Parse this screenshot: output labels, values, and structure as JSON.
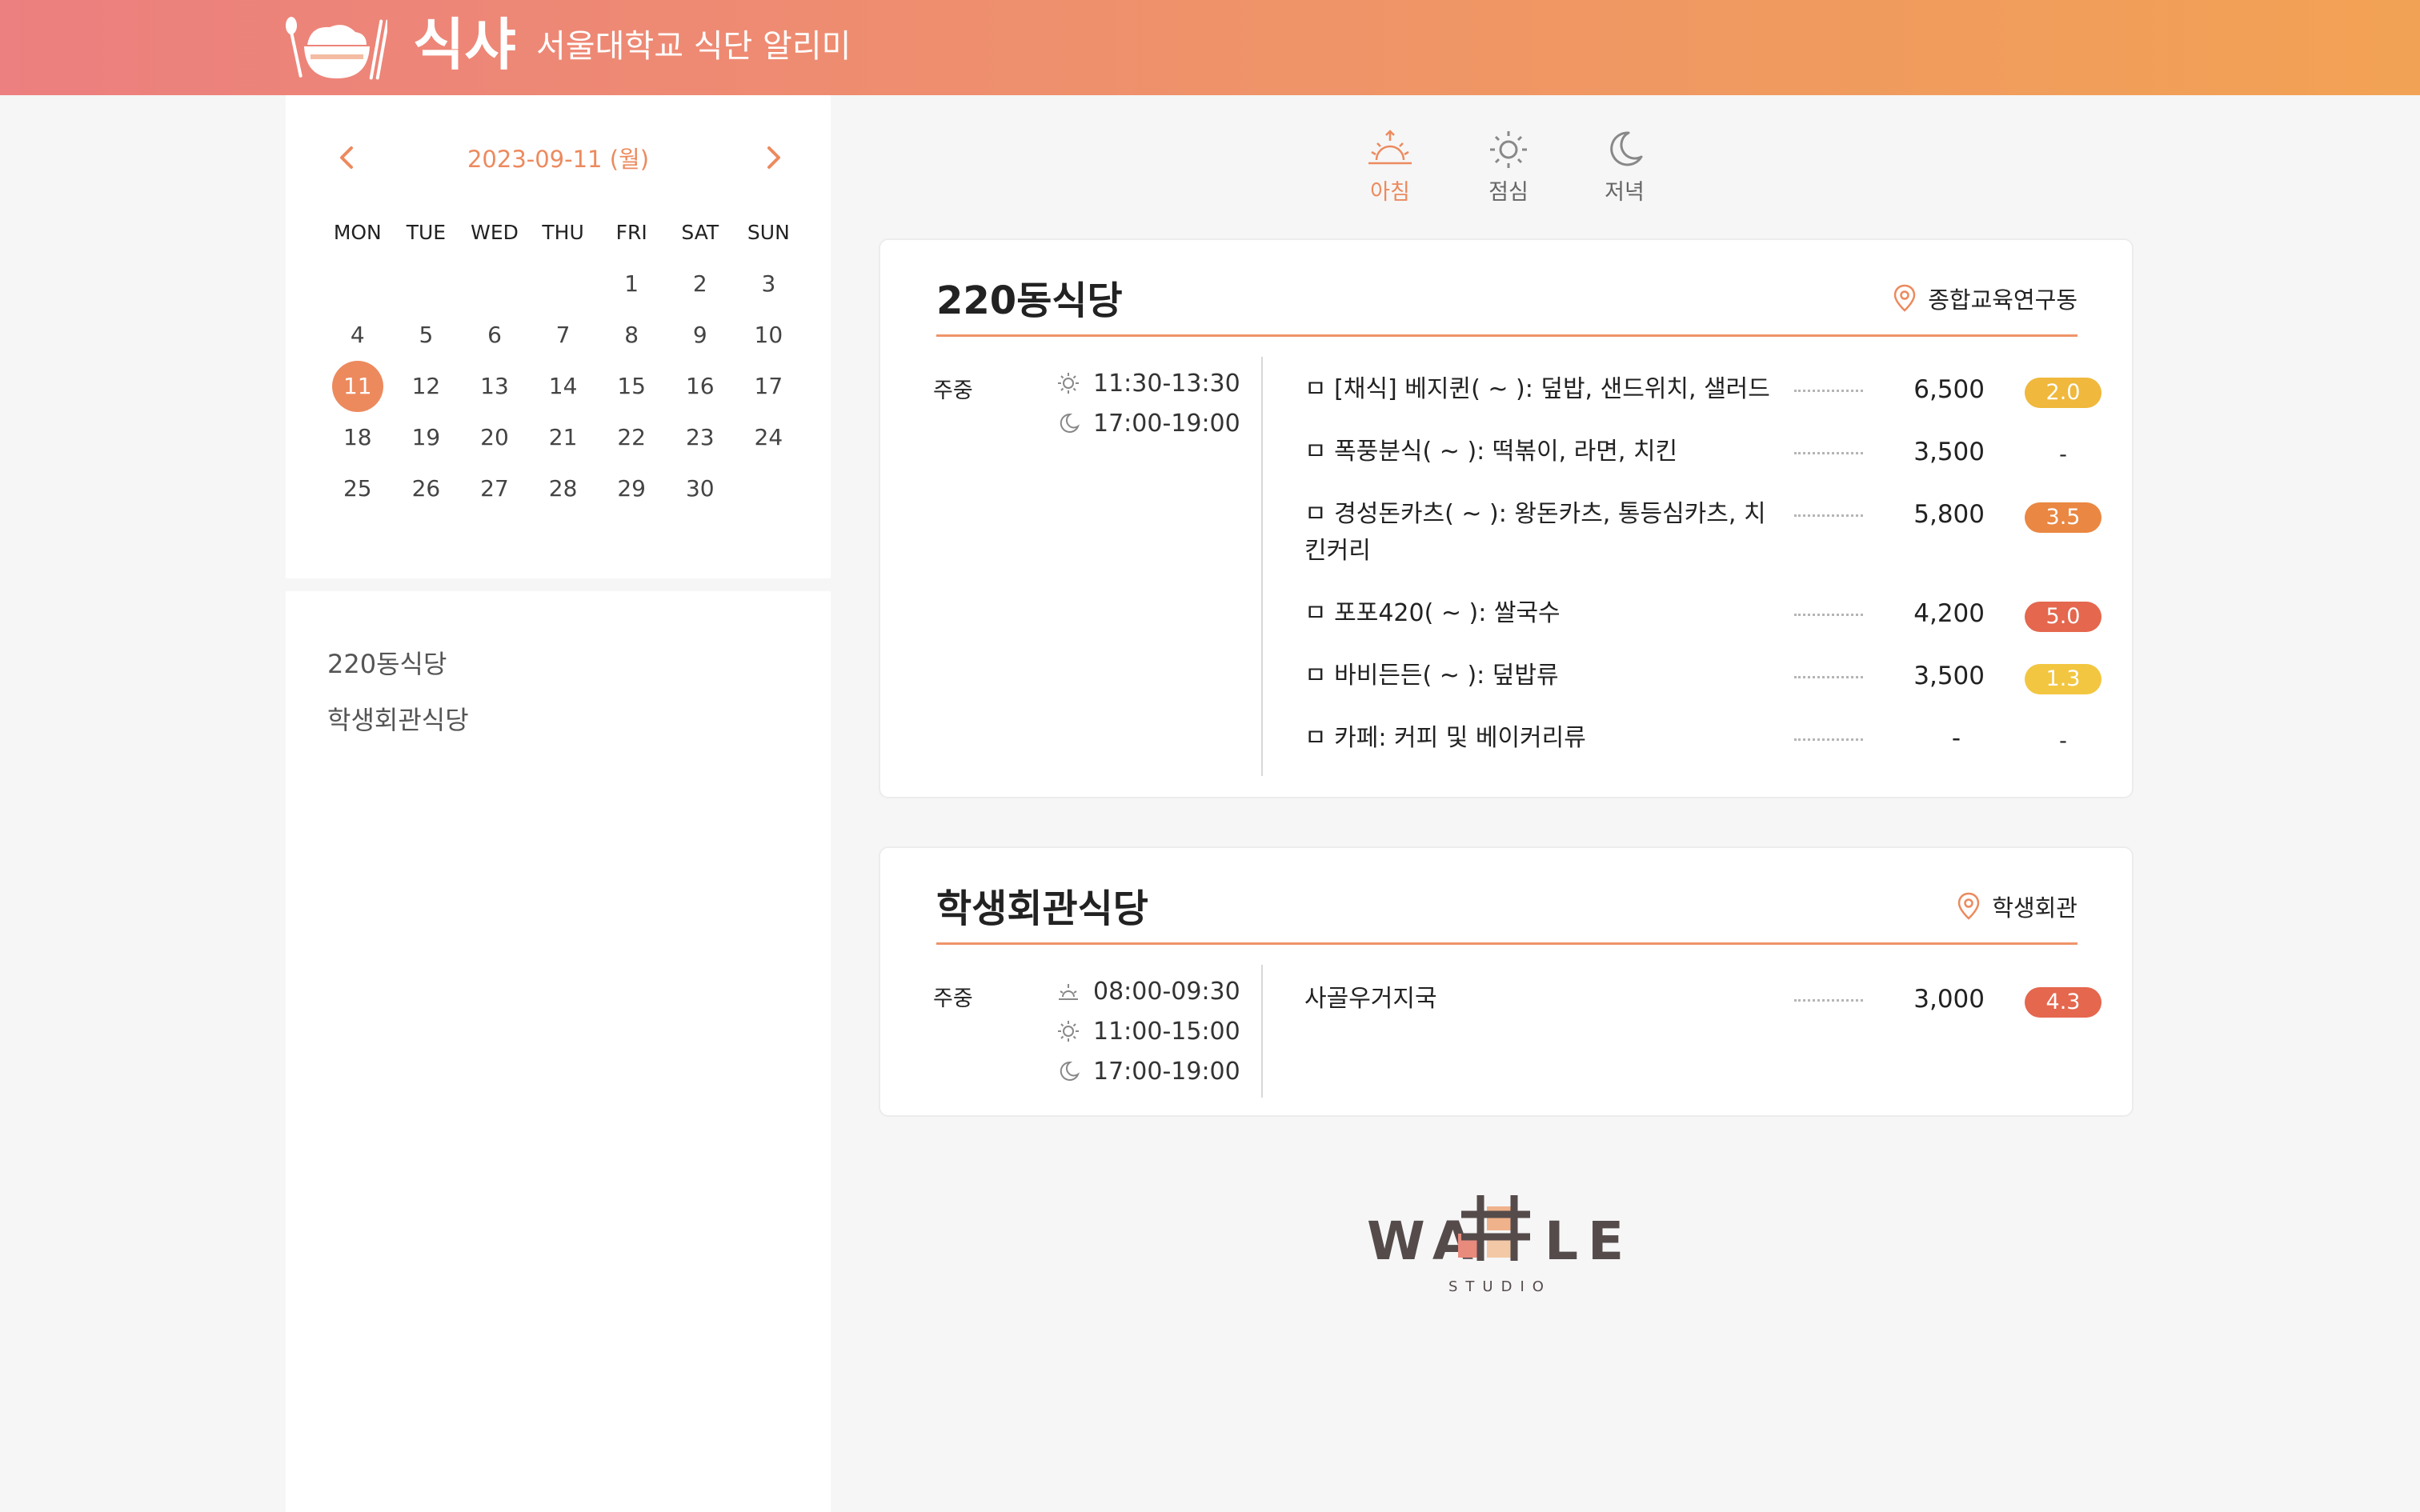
{
  "header": {
    "app_name": "식샤",
    "subtitle": "서울대학교 식단 알리미",
    "colors": {
      "gradient_start": "#ec7f7f",
      "gradient_end": "#f2a254"
    }
  },
  "calendar": {
    "current_date": "2023-09-11 (월)",
    "weekdays": [
      "MON",
      "TUE",
      "WED",
      "THU",
      "FRI",
      "SAT",
      "SUN"
    ],
    "weeks": [
      [
        "",
        "",
        "",
        "",
        "1",
        "2",
        "3"
      ],
      [
        "4",
        "5",
        "6",
        "7",
        "8",
        "9",
        "10"
      ],
      [
        "11",
        "12",
        "13",
        "14",
        "15",
        "16",
        "17"
      ],
      [
        "18",
        "19",
        "20",
        "21",
        "22",
        "23",
        "24"
      ],
      [
        "25",
        "26",
        "27",
        "28",
        "29",
        "30",
        ""
      ]
    ],
    "selected_day": "11",
    "accent_color": "#ec8a5e"
  },
  "restaurant_list": [
    "220동식당",
    "학생회관식당"
  ],
  "meal_tabs": [
    {
      "label": "아침",
      "icon": "sunrise-icon",
      "active": true
    },
    {
      "label": "점심",
      "icon": "sun-icon",
      "active": false
    },
    {
      "label": "저녁",
      "icon": "moon-icon",
      "active": false
    }
  ],
  "restaurants": [
    {
      "name": "220동식당",
      "location": "종합교육연구동",
      "period": "주중",
      "hours": [
        {
          "icon": "sun-icon",
          "time": "11:30-13:30"
        },
        {
          "icon": "moon-icon",
          "time": "17:00-19:00"
        }
      ],
      "menu": [
        {
          "name": "ㅁ [채식] 베지퀸( ~ ): 덮밥, 샌드위치, 샐러드",
          "price": "6,500",
          "rating": "2.0",
          "rating_color": "#f0b83c"
        },
        {
          "name": "ㅁ 폭풍분식( ~ ): 떡볶이, 라면, 치킨",
          "price": "3,500",
          "rating": "-",
          "rating_color": ""
        },
        {
          "name": "ㅁ 경성돈카츠( ~ ): 왕돈카츠, 통등심카츠, 치킨커리",
          "price": "5,800",
          "rating": "3.5",
          "rating_color": "#ea8742"
        },
        {
          "name": "ㅁ 포포420( ~ ): 쌀국수",
          "price": "4,200",
          "rating": "5.0",
          "rating_color": "#e4674e"
        },
        {
          "name": "ㅁ 바비든든( ~ ): 덮밥류",
          "price": "3,500",
          "rating": "1.3",
          "rating_color": "#f2c640"
        },
        {
          "name": "ㅁ 카페: 커피 및 베이커리류",
          "price": "-",
          "rating": "-",
          "rating_color": ""
        }
      ]
    },
    {
      "name": "학생회관식당",
      "location": "학생회관",
      "period": "주중",
      "hours": [
        {
          "icon": "sunrise-icon",
          "time": "08:00-09:30"
        },
        {
          "icon": "sun-icon",
          "time": "11:00-15:00"
        },
        {
          "icon": "moon-icon",
          "time": "17:00-19:00"
        }
      ],
      "menu": [
        {
          "name": "사골우거지국",
          "price": "3,000",
          "rating": "4.3",
          "rating_color": "#e4674e"
        }
      ]
    }
  ],
  "footer": {
    "logo_text": "WA LE",
    "logo_sub": "STUDIO"
  }
}
